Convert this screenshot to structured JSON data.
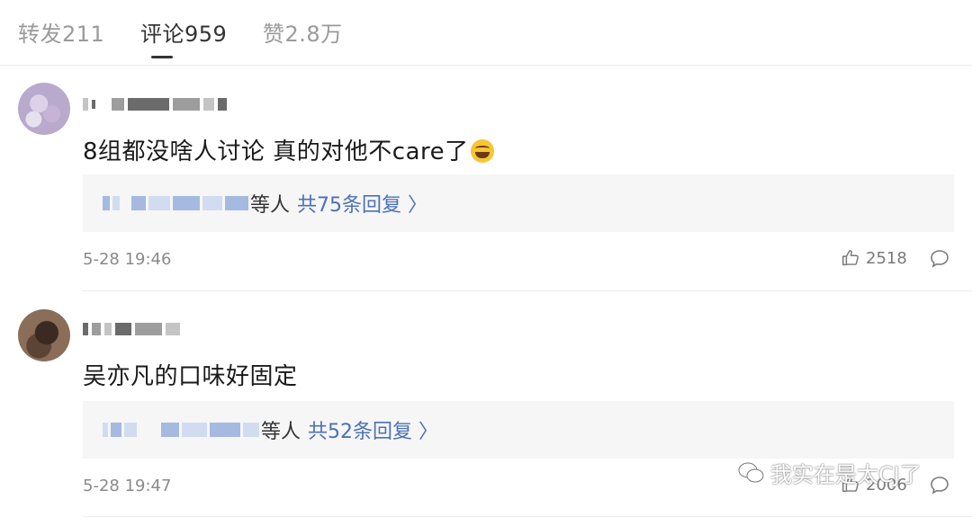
{
  "tabs": [
    {
      "label": "转发211"
    },
    {
      "label": "评论959"
    },
    {
      "label": "赞2.8万"
    }
  ],
  "comments": [
    {
      "text": "8组都没啥人讨论 真的对他不care了",
      "emoji": "laughing-crying-emoji",
      "reply_suffix": "等人",
      "reply_link": "共75条回复",
      "time": "5-28 19:46",
      "likes": "2518"
    },
    {
      "text": "吴亦凡的口味好固定",
      "reply_suffix": "等人",
      "reply_link": "共52条回复",
      "time": "5-28 19:47",
      "likes": "2006"
    }
  ],
  "watermark": {
    "text": "我实在是太CJ了"
  },
  "colors": {
    "link": "#4b71b8",
    "reply_bg": "#f6f6f6",
    "muted": "#8a8a8a"
  }
}
